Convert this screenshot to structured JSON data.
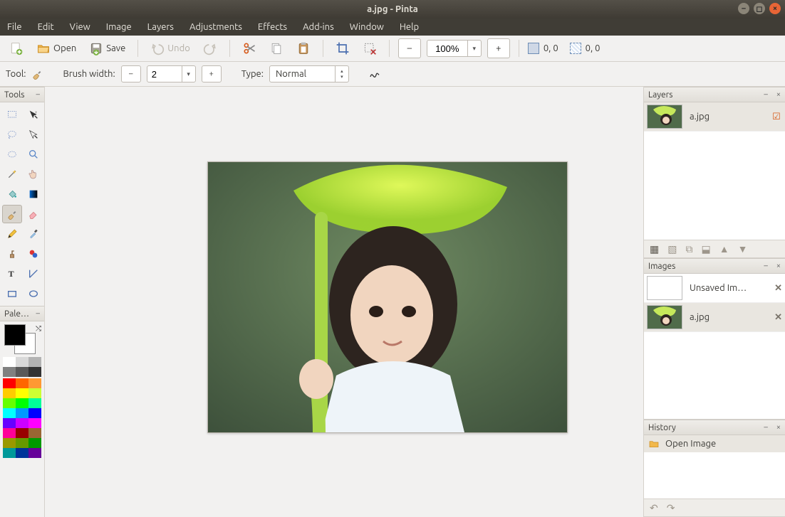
{
  "window": {
    "title": "a.jpg - Pinta"
  },
  "menu": {
    "items": [
      "File",
      "Edit",
      "View",
      "Image",
      "Layers",
      "Adjustments",
      "Effects",
      "Add-ins",
      "Window",
      "Help"
    ]
  },
  "toolbar": {
    "open": "Open",
    "save": "Save",
    "undo": "Undo",
    "zoom_value": "100%",
    "cursor_coords": "0, 0",
    "selection_coords": "0, 0"
  },
  "tool_options": {
    "tool_label": "Tool:",
    "brush_label": "Brush width:",
    "brush_value": "2",
    "type_label": "Type:",
    "type_value": "Normal"
  },
  "panels": {
    "tools_title": "Tools",
    "palette_title": "Pale…",
    "layers_title": "Layers",
    "images_title": "Images",
    "history_title": "History"
  },
  "tools_list": [
    "rectangle-select",
    "move-selected",
    "lasso",
    "move-selection",
    "ellipse-select",
    "zoom",
    "magic-wand",
    "pan",
    "paint-bucket",
    "gradient",
    "paintbrush",
    "eraser",
    "pencil",
    "color-picker",
    "clone-stamp",
    "recolor",
    "text",
    "line-curve",
    "rectangle-shape",
    "ellipse-shape"
  ],
  "selected_tool": "paintbrush",
  "palette_grays": [
    "#ffffff",
    "#d9d9d9",
    "#b3b3b3",
    "#808080",
    "#595959",
    "#333333"
  ],
  "palette_colors": [
    "#ff0000",
    "#ff6600",
    "#ff9933",
    "#ffcc00",
    "#ffff00",
    "#ccff33",
    "#66ff00",
    "#00ff00",
    "#00ff99",
    "#00ffff",
    "#0099ff",
    "#0000ff",
    "#6600ff",
    "#cc00ff",
    "#ff00ff",
    "#ff0099",
    "#990000",
    "#996633",
    "#999900",
    "#669900",
    "#009900",
    "#009999",
    "#003399",
    "#660099"
  ],
  "layers": [
    {
      "name": "a.jpg",
      "visible": true,
      "thumb": "photo"
    }
  ],
  "images": [
    {
      "name": "Unsaved Im…",
      "thumb": "blank",
      "selected": false
    },
    {
      "name": "a.jpg",
      "thumb": "photo",
      "selected": true
    }
  ],
  "history": [
    {
      "label": "Open Image"
    }
  ]
}
